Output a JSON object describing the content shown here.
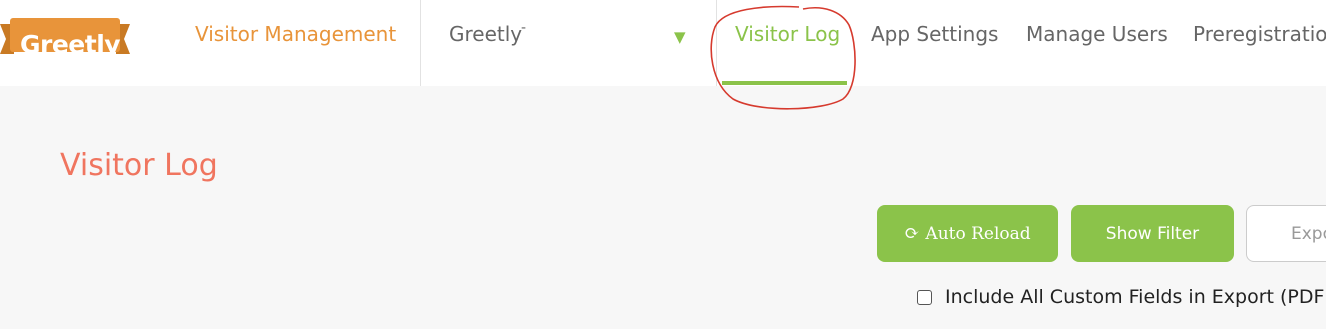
{
  "brand": {
    "logo_text": "Greetly",
    "logo_color": "#e8943a"
  },
  "nav": {
    "visitor_management": "Visitor Management",
    "account_name": "Greetly",
    "account_mark": "-",
    "tabs": [
      {
        "label": "Visitor Log",
        "active": true
      },
      {
        "label": "App Settings",
        "active": false
      },
      {
        "label": "Manage Users",
        "active": false
      },
      {
        "label": "Preregistration",
        "active": false
      }
    ]
  },
  "main": {
    "title": "Visitor Log",
    "buttons": {
      "auto_reload": "Auto Reload",
      "show_filter": "Show Filter",
      "export": "Export"
    },
    "include_custom_fields": {
      "label": "Include All Custom Fields in Export (PDF",
      "checked": false
    }
  },
  "colors": {
    "accent_green": "#8bc34a",
    "accent_orange": "#e8943a",
    "title_coral": "#f0755f",
    "annotation_red": "#d63a2e"
  }
}
